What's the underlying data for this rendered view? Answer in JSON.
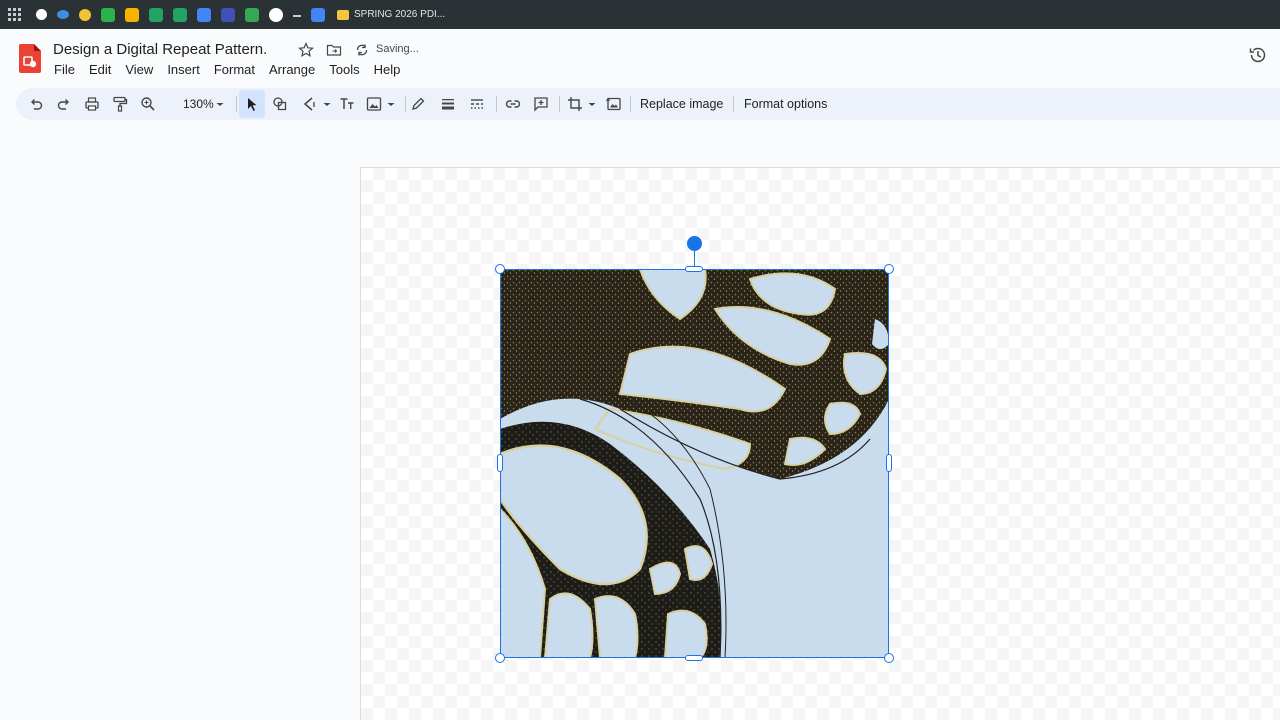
{
  "bookmarks": {
    "folder_label": "SPRING 2026 PDI...",
    "icons": [
      "apps-grid-icon",
      "circle-app-icon",
      "cloud-icon",
      "chrome-icon",
      "android-icon",
      "classroom-icon",
      "sheets-icon",
      "sheets-icon-2",
      "docs-icon",
      "forms-icon",
      "photos-icon",
      "google-icon",
      "dash-icon",
      "docs-icon-2"
    ],
    "colors": {
      "bar": "#2b3236",
      "folder": "#f4c542"
    }
  },
  "app": {
    "title": "Design a Digital Repeat Pattern.",
    "status": "Saving...",
    "logo_color": "#ea4335",
    "menus": [
      "File",
      "Edit",
      "View",
      "Insert",
      "Format",
      "Arrange",
      "Tools",
      "Help"
    ]
  },
  "toolbar": {
    "zoom": "130%",
    "replace_image": "Replace image",
    "format_options": "Format options",
    "icons": [
      "undo-icon",
      "redo-icon",
      "print-icon",
      "paint-format-icon",
      "zoom-icon",
      "zoom-dropdown-icon",
      "select-icon",
      "shape-icon",
      "line-icon",
      "text-box-icon",
      "image-icon",
      "pen-icon",
      "line-weight-icon",
      "line-dash-icon",
      "link-icon",
      "comment-icon",
      "crop-icon",
      "reset-image-icon"
    ],
    "accent": "#1a73e8",
    "selected_bg": "#d3e3fd"
  },
  "canvas": {
    "image_subject": "butterfly wing close-up",
    "image_bg_color": "#c9dcee",
    "wing_colors": [
      "#2a2418",
      "#6b5a3a",
      "#d8d0a0",
      "#c9dcee"
    ]
  }
}
